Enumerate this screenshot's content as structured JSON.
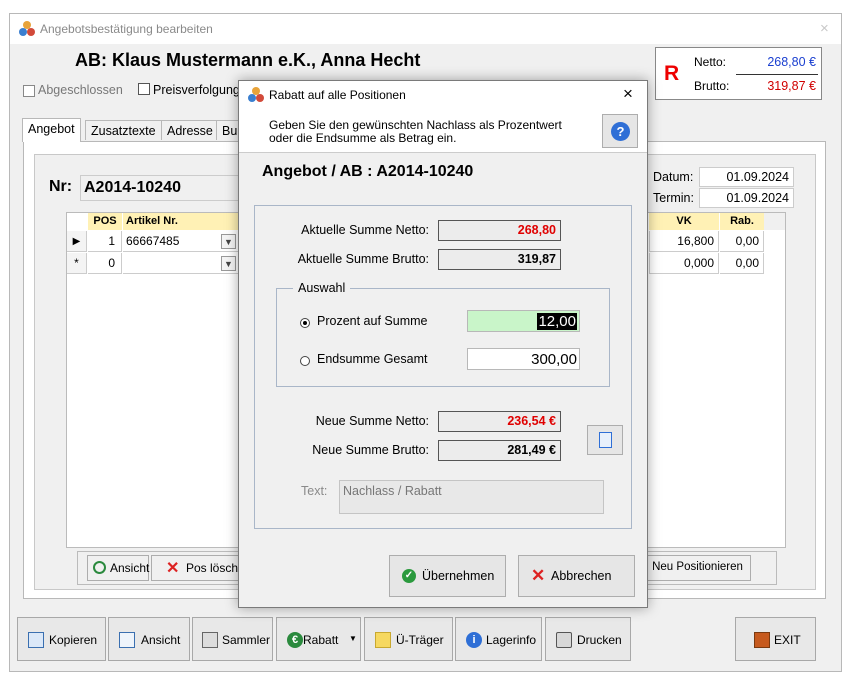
{
  "main_window": {
    "title": "Angebotsbestätigung bearbeiten",
    "close_glyph": "×",
    "heading": "AB: Klaus Mustermann e.K., Anna Hecht",
    "checkboxes": {
      "abgeschlossen": "Abgeschlossen",
      "preisverfolgung": "Preisverfolgung"
    },
    "totals": {
      "badge": "R",
      "netto_label": "Netto:",
      "netto_value": "268,80 €",
      "brutto_label": "Brutto:",
      "brutto_value": "319,87 €"
    },
    "tabs": [
      "Angebot",
      "Zusatztexte",
      "Adresse",
      "Bu"
    ],
    "nr_label": "Nr:",
    "nr_value": "A2014-10240",
    "datum_label": "Datum:",
    "datum_value": "01.09.2024",
    "termin_label": "Termin:",
    "termin_value": "01.09.2024",
    "grid": {
      "columns": {
        "pos": "POS",
        "artikel": "Artikel Nr.",
        "vk": "VK",
        "rab": "Rab."
      },
      "rows": [
        {
          "marker": "▶",
          "pos": "1",
          "artikel": "66667485",
          "vk": "16,800",
          "rab": "0,00"
        },
        {
          "marker": "*",
          "pos": "0",
          "artikel": "",
          "vk": "0,000",
          "rab": "0,00"
        }
      ]
    },
    "grid_buttons": {
      "ansicht": "Ansicht",
      "pos_loeschen": "Pos löschen",
      "neu_positionieren": "Neu Positionieren"
    },
    "toolbar": {
      "kopieren": "Kopieren",
      "ansicht": "Ansicht",
      "sammler": "Sammler",
      "rabatt": "Rabatt",
      "ue_traeger": "Ü-Träger",
      "lagerinfo": "Lagerinfo",
      "drucken": "Drucken",
      "exit": "EXIT"
    }
  },
  "dialog": {
    "title": "Rabatt auf alle Positionen",
    "close_glyph": "×",
    "info_line1": "Geben Sie den gewünschten Nachlass als Prozentwert",
    "info_line2": "oder die Endsumme als Betrag ein.",
    "heading": "Angebot / AB : A2014-10240",
    "aktuelle_netto_label": "Aktuelle Summe Netto:",
    "aktuelle_netto_value": "268,80",
    "aktuelle_brutto_label": "Aktuelle Summe Brutto:",
    "aktuelle_brutto_value": "319,87",
    "auswahl_legend": "Auswahl",
    "prozent_label": "Prozent auf Summe",
    "prozent_value": "12,00",
    "endsumme_label": "Endsumme Gesamt",
    "endsumme_value": "300,00",
    "neue_netto_label": "Neue Summe Netto:",
    "neue_netto_value": "236,54 €",
    "neue_brutto_label": "Neue Summe Brutto:",
    "neue_brutto_value": "281,49 €",
    "text_label": "Text:",
    "text_value": "Nachlass / Rabatt",
    "uebernehmen": "Übernehmen",
    "abbrechen": "Abbrechen"
  },
  "colors": {
    "netto_blue": "#1a3fd0",
    "brutto_red": "#d00000",
    "grid_header": "#fff1b5",
    "percent_field": "#c9f5c9",
    "selection": "#000000"
  }
}
